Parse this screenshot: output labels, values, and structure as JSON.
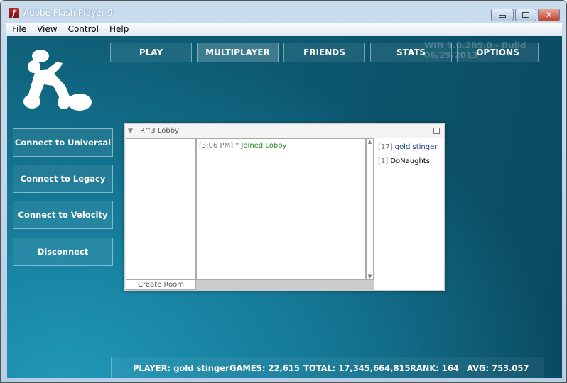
{
  "window": {
    "title": "Adobe Flash Player 9",
    "icon": "flash-icon"
  },
  "menu": [
    "File",
    "View",
    "Control",
    "Help"
  ],
  "build_text": "WIN 9.0.289.0 - Build 06/29/2013",
  "nav": [
    {
      "label": "PLAY"
    },
    {
      "label": "MULTIPLAYER",
      "active": true
    },
    {
      "label": "FRIENDS"
    },
    {
      "label": "STATS"
    },
    {
      "label": "OPTIONS"
    }
  ],
  "left_buttons": [
    "Connect to Universal",
    "Connect to Legacy",
    "Connect to Velocity",
    "Disconnect"
  ],
  "lobby": {
    "title": "R^3 Lobby",
    "create_room": "Create Room",
    "chat": [
      {
        "time": "[3:06 PM]",
        "text": "* Joined Lobby"
      }
    ],
    "users": [
      {
        "level": "[17]",
        "name": "gold stinger"
      },
      {
        "level": "[1]",
        "name": "DoNaughts"
      }
    ]
  },
  "footer": {
    "player": "PLAYER: gold stinger",
    "games": "GAMES: 22,615",
    "total": "TOTAL: 17,345,664,815",
    "rank": "RANK: 164",
    "avg": "AVG: 753.057"
  },
  "colors": {
    "accent": "#0e5f78",
    "chat_green": "#2a8a2a",
    "self_blue": "#1a3e8c"
  }
}
